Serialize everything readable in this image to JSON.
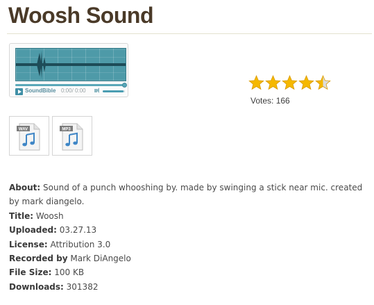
{
  "title": "Woosh Sound",
  "player": {
    "brand": "SoundBible",
    "time": "0:00/ 0:00",
    "progress": 1.0,
    "volume": 0.95
  },
  "rating": {
    "stars": 4.5,
    "max": 5,
    "votes_text": "Votes: 166",
    "star_color": "#f5b800"
  },
  "downloads": [
    {
      "format": "WAV"
    },
    {
      "format": "MP3"
    }
  ],
  "info": {
    "about_label": "About:",
    "about_value": "Sound of a punch whooshing by. made by swinging a stick near mic. created by mark diangelo.",
    "title_label": "Title:",
    "title_value": "Woosh",
    "uploaded_label": "Uploaded:",
    "uploaded_value": "03.27.13",
    "license_label": "License:",
    "license_value": "Attribution 3.0",
    "recorded_label": "Recorded by",
    "recorded_value": "Mark DiAngelo",
    "filesize_label": "File Size:",
    "filesize_value": "100 KB",
    "downloads_label": "Downloads:",
    "downloads_value": "301382"
  }
}
